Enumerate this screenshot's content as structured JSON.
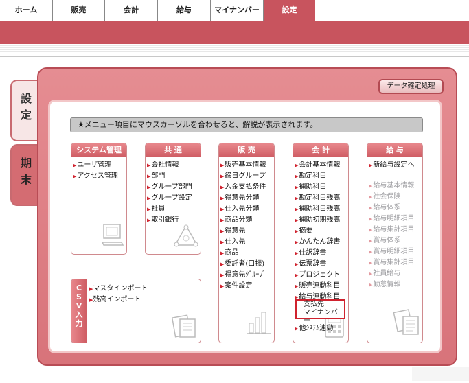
{
  "nav": {
    "tabs": [
      "ホーム",
      "販売",
      "会計",
      "給与",
      "マイナンバー",
      "設定"
    ],
    "active_tab": "設定"
  },
  "side_tabs": [
    "設定",
    "期末"
  ],
  "confirm_button": "データ確定処理",
  "info_message": "★メニュー項目にマウスカーソルを合わせると、解説が表示されます。",
  "panels": {
    "system": {
      "title": "システム管理",
      "items": [
        "ユーザ管理",
        "アクセス管理"
      ]
    },
    "common": {
      "title": "共 通",
      "items": [
        "会社情報",
        "部門",
        "グループ部門",
        "グループ設定",
        "社員",
        "取引銀行"
      ]
    },
    "sales": {
      "title": "販 売",
      "items": [
        "販売基本情報",
        "締日グループ",
        "入金支払条件",
        "得意先分類",
        "仕入先分類",
        "商品分類",
        "得意先",
        "仕入先",
        "商品",
        "委託者(口振)",
        "得意先ｸﾞﾙｰﾌﾟ",
        "案件設定"
      ]
    },
    "accounting": {
      "title": "会 計",
      "items": [
        "会計基本情報",
        "勘定科目",
        "補助科目",
        "勘定科目残高",
        "補助科目残高",
        "補助初期残高",
        "摘要",
        "かんたん辞書",
        "仕訳辞書",
        "伝票辞書",
        "プロジェクト",
        "販売連動科目",
        "給与連動科目"
      ],
      "highlight": [
        "支払先",
        "マイナンバー"
      ],
      "last": "他ｼｽﾃﾑ連動"
    },
    "payroll": {
      "title": "給 与",
      "items": [
        "新給与設定へ"
      ],
      "dim_items": [
        "給与基本情報",
        "社会保険",
        "給与体系",
        "給与明細項目",
        "給与集計項目",
        "賞与体系",
        "賞与明細項目",
        "賞与集計項目",
        "社員給与",
        "勤怠情報"
      ]
    }
  },
  "csv": {
    "title": "CSV入力",
    "items": [
      "マスタインポート",
      "残高インポート"
    ]
  },
  "colors": {
    "accent": "#c8545e",
    "arrow": "#d0222e",
    "highlight": "#d0222e"
  }
}
